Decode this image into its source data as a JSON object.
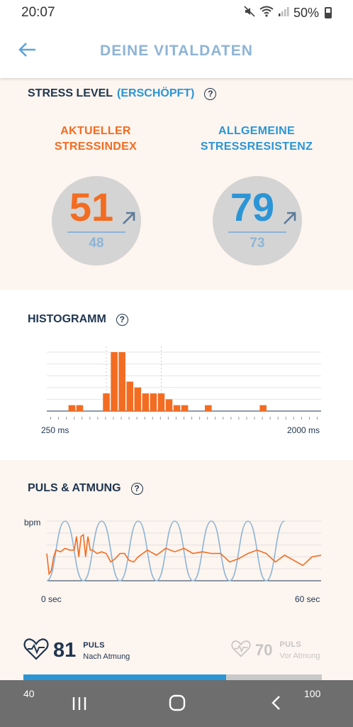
{
  "status_bar": {
    "time": "20:07",
    "battery": "50%"
  },
  "app_bar": {
    "title": "DEINE VITALDATEN"
  },
  "stress": {
    "heading": "STRESS LEVEL",
    "state": "(ERSCHÖPFT)",
    "current": {
      "title_line1": "AKTUELLER",
      "title_line2": "STRESSINDEX",
      "value": "51",
      "previous": "48",
      "color": "#f36c21"
    },
    "resistance": {
      "title_line1": "ALLGEMEINE",
      "title_line2": "STRESSRESISTENZ",
      "value": "79",
      "previous": "73",
      "color": "#2b95d6"
    }
  },
  "histogram": {
    "heading": "HISTOGRAMM",
    "x_min_label": "250 ms",
    "x_max_label": "2000 ms"
  },
  "puls_atmung": {
    "heading": "PULS & ATMUNG",
    "y_label": "bpm",
    "x_min_label": "0 sec",
    "x_max_label": "60 sec",
    "after": {
      "value": "81",
      "title": "PULS",
      "subtitle": "Nach Atmung"
    },
    "before": {
      "value": "70",
      "title": "PULS",
      "subtitle": "Vor Atmung"
    },
    "progress_fraction": 0.68,
    "range_min": "40",
    "range_max": "100"
  },
  "chart_data": [
    {
      "type": "bar",
      "title": "HISTOGRAMM",
      "x_range_ms": [
        250,
        2000
      ],
      "bins": [
        {
          "x": 410,
          "count": 1
        },
        {
          "x": 460,
          "count": 1
        },
        {
          "x": 630,
          "count": 3
        },
        {
          "x": 680,
          "count": 10
        },
        {
          "x": 730,
          "count": 10
        },
        {
          "x": 780,
          "count": 5
        },
        {
          "x": 830,
          "count": 4
        },
        {
          "x": 880,
          "count": 3
        },
        {
          "x": 930,
          "count": 3
        },
        {
          "x": 980,
          "count": 3
        },
        {
          "x": 1030,
          "count": 2
        },
        {
          "x": 1080,
          "count": 1
        },
        {
          "x": 1130,
          "count": 1
        },
        {
          "x": 1280,
          "count": 1
        },
        {
          "x": 1630,
          "count": 1
        }
      ],
      "ylim": [
        0,
        10
      ],
      "color": "#f36c21"
    },
    {
      "type": "line",
      "title": "PULS & ATMUNG",
      "ylabel": "bpm",
      "xlim": [
        0,
        60
      ],
      "series": [
        {
          "color": "#f36c21",
          "x": [
            0,
            0.5,
            1,
            1.5,
            2,
            3,
            4,
            5,
            6,
            6.5,
            7,
            7.5,
            8,
            8.5,
            9,
            9.5,
            10,
            11,
            12,
            13,
            14,
            15,
            16,
            17,
            18,
            19,
            20,
            22,
            24,
            26,
            28,
            30,
            32,
            34,
            36,
            38,
            40,
            42,
            44,
            46,
            48,
            50,
            52,
            54,
            56,
            58,
            60
          ],
          "y": [
            76,
            64,
            66,
            74,
            78,
            77,
            79,
            78,
            78,
            86,
            74,
            86,
            87,
            74,
            86,
            78,
            78,
            76,
            77,
            76,
            71,
            73,
            76,
            76,
            72,
            71,
            74,
            78,
            75,
            79,
            77,
            79,
            76,
            77,
            76,
            76,
            71,
            73,
            76,
            78,
            76,
            71,
            75,
            72,
            69,
            74,
            75
          ]
        },
        {
          "color": "#8db4d6",
          "x": [
            0,
            4,
            8,
            12,
            16,
            20,
            24,
            28,
            32,
            36,
            40,
            44,
            48,
            52
          ],
          "y": [
            60,
            95,
            60,
            95,
            60,
            95,
            60,
            95,
            60,
            95,
            60,
            95,
            60,
            95
          ]
        }
      ]
    }
  ]
}
